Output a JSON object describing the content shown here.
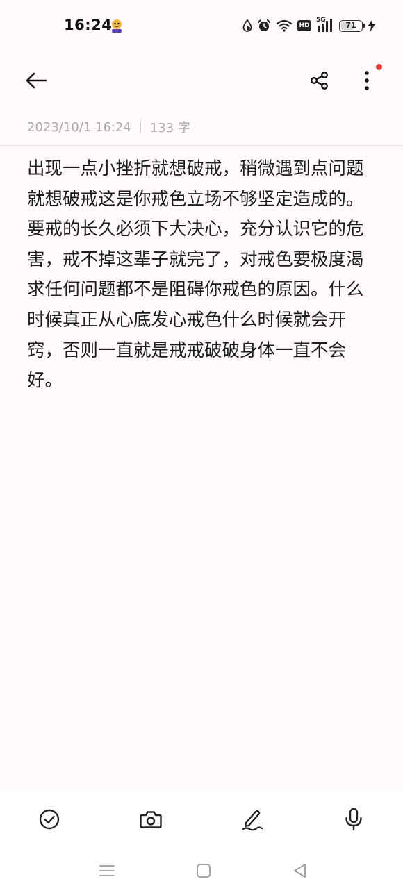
{
  "status_bar": {
    "time": "16:24",
    "network_label": "5G",
    "hd_label": "HD",
    "battery_level": "71",
    "battery_fraction": 0.71,
    "icons": [
      "app-mascot-icon",
      "data-saver-icon",
      "alarm-icon",
      "wifi-icon",
      "hd-icon",
      "signal-icon",
      "battery-icon",
      "charging-icon"
    ]
  },
  "toolbar": {
    "icons": [
      "back-arrow-icon",
      "share-icon",
      "more-vertical-icon"
    ],
    "notification_dot_color": "#e53935"
  },
  "note": {
    "date": "2023/10/1 16:24",
    "word_count": "133 字",
    "body": "出现一点小挫折就想破戒，稍微遇到点问题就想破戒这是你戒色立场不够坚定造成的。要戒的长久必须下大决心，充分认识它的危害，戒不掉这辈子就完了，对戒色要极度渴求任何问题都不是阻碍你戒色的原因。什么时候真正从心底发心戒色什么时候就会开窍，否则一直就是戒戒破破身体一直不会好。"
  },
  "bottom_toolbar": {
    "icons": [
      "todo-check-icon",
      "camera-icon",
      "handwriting-pen-icon",
      "microphone-icon"
    ]
  },
  "nav_bar": {
    "icons": [
      "menu-lines-icon",
      "home-square-icon",
      "back-triangle-icon"
    ]
  },
  "colors": {
    "background": "#fdf9fd",
    "meta_text": "#a9a9a9",
    "body_text": "#1c1c1c",
    "accent_red": "#e53935"
  }
}
